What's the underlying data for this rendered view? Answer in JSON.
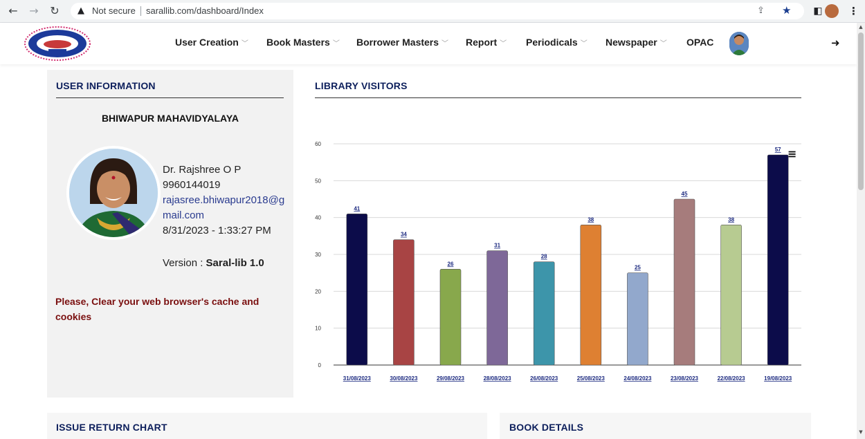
{
  "browser": {
    "security_label": "Not secure",
    "url": "sarallib.com/dashboard/Index"
  },
  "nav": {
    "items": [
      "User Creation",
      "Book Masters",
      "Borrower Masters",
      "Report",
      "Periodicals",
      "Newspaper",
      "OPAC"
    ],
    "has_dropdown": [
      true,
      true,
      true,
      true,
      true,
      true,
      false
    ]
  },
  "user_info": {
    "title": "USER INFORMATION",
    "college": "BHIWAPUR MAHAVIDYALAYA",
    "name": "Dr. Rajshree O P",
    "phone": "9960144019",
    "email": "rajasree.bhiwapur2018@gmail.com",
    "datetime": "8/31/2023 - 1:33:27 PM",
    "version_label": "Version : ",
    "version_value": "Saral-lib 1.0",
    "cache_message": "Please, Clear your web browser's cache and cookies"
  },
  "visitors": {
    "title": "LIBRARY VISITORS"
  },
  "chart_data": {
    "type": "bar",
    "categories": [
      "31/08/2023",
      "30/08/2023",
      "29/08/2023",
      "28/08/2023",
      "26/08/2023",
      "25/08/2023",
      "24/08/2023",
      "23/08/2023",
      "22/08/2023",
      "19/08/2023"
    ],
    "values": [
      41,
      34,
      26,
      31,
      28,
      38,
      25,
      45,
      38,
      57
    ],
    "colors": [
      "#0c0c4a",
      "#a84444",
      "#88a84c",
      "#7e6898",
      "#3d95aa",
      "#de8032",
      "#92a8cc",
      "#a67c7c",
      "#b7cb91",
      "#0c0c4a"
    ],
    "yticks": [
      0,
      10,
      20,
      30,
      40,
      50,
      60
    ],
    "ylim": [
      0,
      60
    ],
    "grid": true,
    "legend": "none"
  },
  "bottom": {
    "issue_title": "ISSUE RETURN CHART",
    "book_title": "BOOK DETAILS"
  }
}
